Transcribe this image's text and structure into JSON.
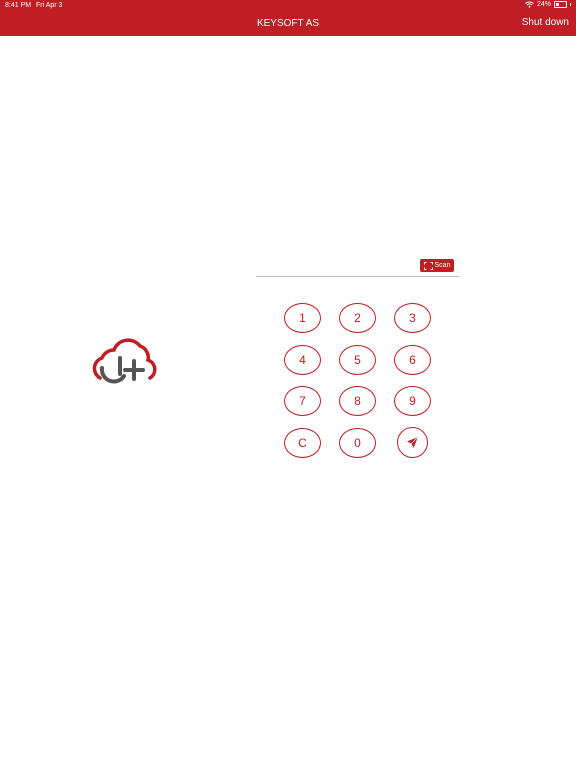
{
  "status_bar": {
    "time": "8:41 PM",
    "date": "Fri Apr 3",
    "battery": "24%",
    "icons": [
      "wifi-icon",
      "battery-icon"
    ]
  },
  "header": {
    "title": "KEYSOFT AS",
    "shutdown_label": "Shut down"
  },
  "scan": {
    "label": "Scan",
    "icon": "scan-frame-icon"
  },
  "keypad": {
    "keys": [
      "1",
      "2",
      "3",
      "4",
      "5",
      "6",
      "7",
      "8",
      "9",
      "C",
      "0"
    ],
    "send_icon": "send-arrow-icon"
  },
  "logo": {
    "icon": "cloud-plus-logo"
  },
  "colors": {
    "accent": "#bf1e24",
    "logo_dark": "#555555"
  }
}
